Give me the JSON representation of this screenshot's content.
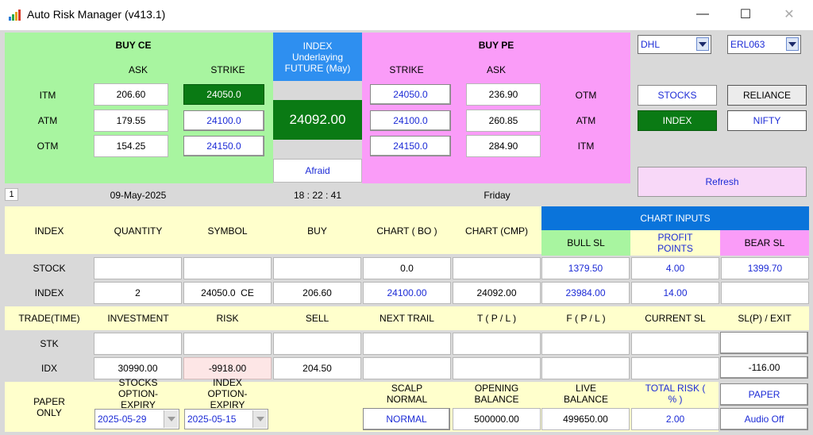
{
  "window": {
    "title": "Auto Risk Manager (v413.1)",
    "minimize": "—",
    "maximize": "☐",
    "close": "✕"
  },
  "buyce": {
    "title": "BUY CE",
    "ask_head": "ASK",
    "strike_head": "STRIKE",
    "rows": [
      {
        "label": "ITM",
        "ask": "206.60",
        "strike": "24050.0"
      },
      {
        "label": "ATM",
        "ask": "179.55",
        "strike": "24100.0"
      },
      {
        "label": "OTM",
        "ask": "154.25",
        "strike": "24150.0"
      }
    ]
  },
  "index_panel": {
    "line1": "INDEX",
    "line2": "Underlaying",
    "line3": "FUTURE (May)",
    "price": "24092.00",
    "mood": "Afraid"
  },
  "buype": {
    "title": "BUY PE",
    "strike_head": "STRIKE",
    "ask_head": "ASK",
    "rows": [
      {
        "strike": "24050.0",
        "ask": "236.90",
        "label": "OTM"
      },
      {
        "strike": "24100.0",
        "ask": "260.85",
        "label": "ATM"
      },
      {
        "strike": "24150.0",
        "ask": "284.90",
        "label": "ITM"
      }
    ]
  },
  "right": {
    "broker": "DHL",
    "account": "ERL063",
    "stocks_btn": "STOCKS",
    "stock_name": "RELIANCE",
    "index_btn": "INDEX",
    "index_name": "NIFTY",
    "refresh": "Refresh"
  },
  "info": {
    "tab": "1",
    "date": "09-May-2025",
    "time": "18 : 22 : 41",
    "day": "Friday"
  },
  "grid": {
    "h1": [
      "INDEX",
      "QUANTITY",
      "SYMBOL",
      "BUY",
      "CHART ( BO )",
      "CHART (CMP)"
    ],
    "chart_inputs": "CHART INPUTS",
    "h1b": [
      "BULL SL",
      "PROFIT POINTS",
      "BEAR SL"
    ],
    "stock": {
      "label": "STOCK",
      "quantity": "",
      "symbol": "",
      "buy": "",
      "chart_bo": "0.0",
      "chart_cmp": "",
      "bull_sl": "1379.50",
      "profit_points": "4.00",
      "bear_sl": "1399.70"
    },
    "index": {
      "label": "INDEX",
      "quantity": "2",
      "symbol": "24050.0  CE",
      "buy": "206.60",
      "chart_bo": "24100.00",
      "chart_cmp": "24092.00",
      "bull_sl": "23984.00",
      "profit_points": "14.00",
      "bear_sl": ""
    },
    "h2": [
      "TRADE(TIME)",
      "INVESTMENT",
      "RISK",
      "SELL",
      "NEXT TRAIL",
      "T ( P / L )",
      "F ( P / L )",
      "CURRENT SL",
      "SL(P) / EXIT"
    ],
    "stk": {
      "label": "STK",
      "investment": "",
      "risk": "",
      "sell": "",
      "next_trail": "",
      "t_pl": "",
      "f_pl": "",
      "current_sl": "",
      "sl_exit": ""
    },
    "idx": {
      "label": "IDX",
      "investment": "30990.00",
      "risk": "-9918.00",
      "sell": "204.50",
      "next_trail": "",
      "t_pl": "",
      "f_pl": "",
      "current_sl": "",
      "sl_exit": "-116.00"
    },
    "paper_only": "PAPER ONLY",
    "stocks_expiry_label": "STOCKS OPTION-EXPIRY",
    "stocks_expiry": "2025-05-29",
    "index_expiry_label": "INDEX OPTION-EXPIRY",
    "index_expiry": "2025-05-15",
    "scalp_label": "SCALP NORMAL",
    "scalp_value": "NORMAL",
    "opening_label": "OPENING BALANCE",
    "opening_value": "500000.00",
    "live_label": "LIVE BALANCE",
    "live_value": "499650.00",
    "risk_label": "TOTAL RISK ( % )",
    "risk_value": "2.00",
    "paper_btn": "PAPER",
    "audio_btn": "Audio Off"
  }
}
